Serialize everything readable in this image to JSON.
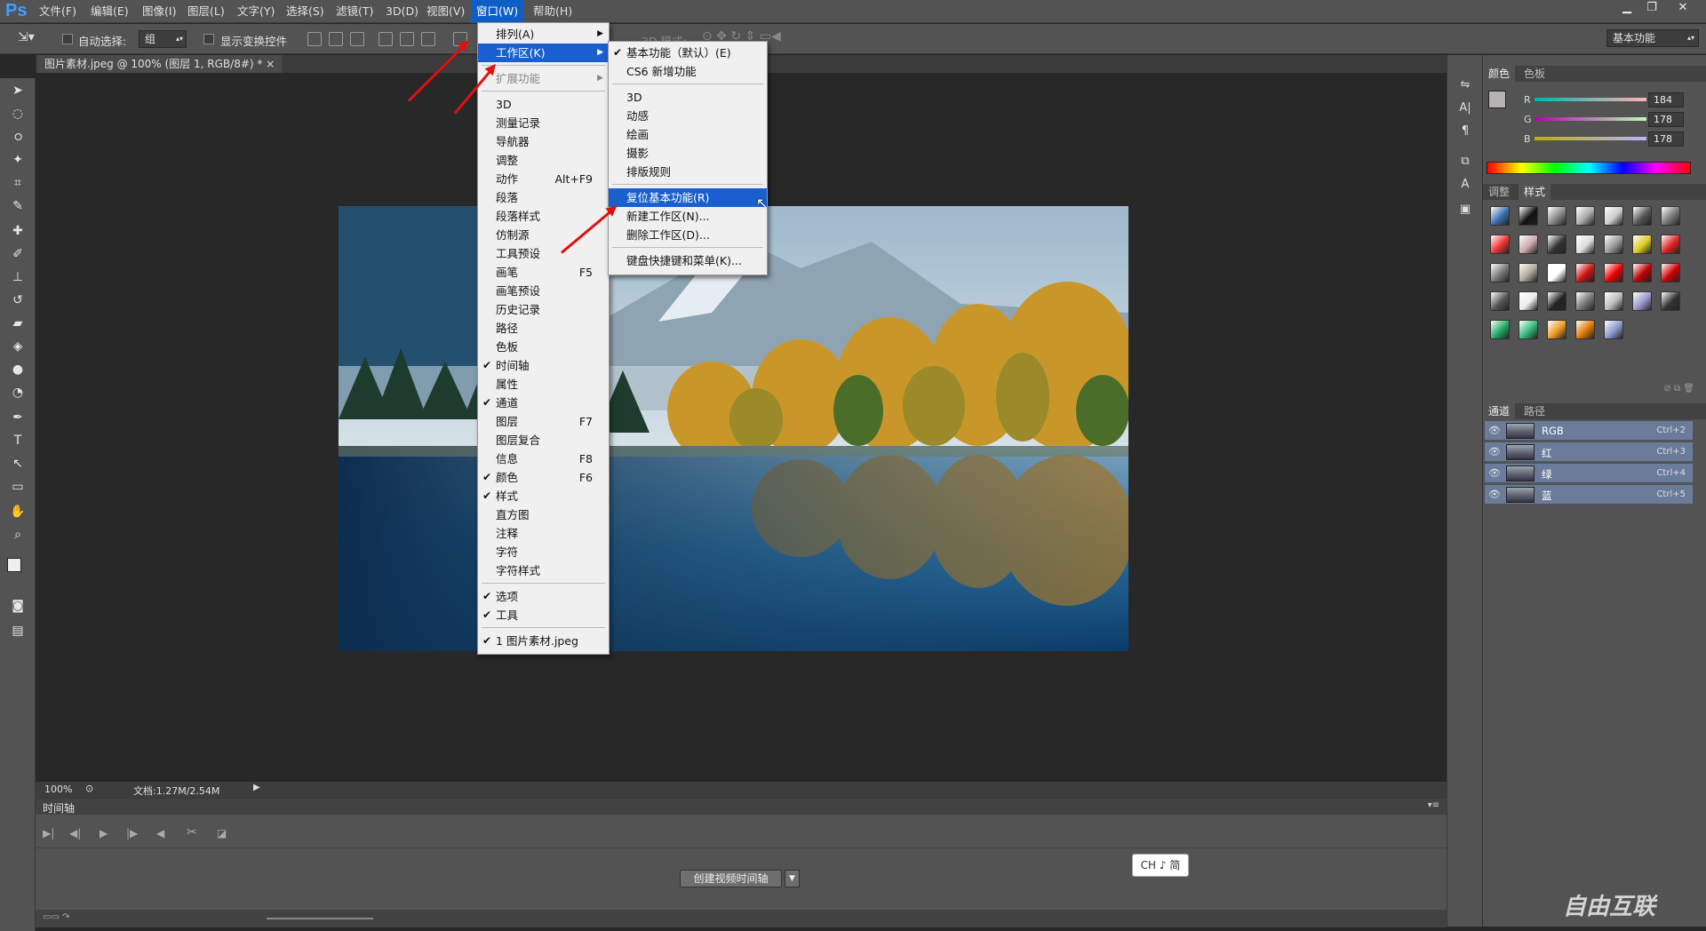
{
  "app": {
    "logo": "Ps"
  },
  "menubar": {
    "items": [
      "文件(F)",
      "编辑(E)",
      "图像(I)",
      "图层(L)",
      "文字(Y)",
      "选择(S)",
      "滤镜(T)",
      "3D(D)",
      "视图(V)",
      "窗口(W)",
      "帮助(H)"
    ],
    "active_index": 9
  },
  "window_controls": [
    "minimize",
    "restore",
    "close"
  ],
  "options": {
    "auto_select_label": "自动选择:",
    "auto_select_value": "组",
    "show_transform_label": "显示变换控件",
    "mode_partial": "3D 模式:",
    "workspace": "基本功能"
  },
  "document": {
    "tab_label": "图片素材.jpeg @ 100% (图层 1, RGB/8#) *",
    "close_glyph": "×"
  },
  "status": {
    "zoom": "100%",
    "doc_info": "文档:1.27M/2.54M"
  },
  "timeline": {
    "tab": "时间轴",
    "create_button": "创建视频时间轴"
  },
  "ime": {
    "text": "CH ♪ 简"
  },
  "color_panel": {
    "tabs": [
      "颜色",
      "色板"
    ],
    "channels": [
      {
        "name": "R",
        "value": "184"
      },
      {
        "name": "G",
        "value": "178"
      },
      {
        "name": "B",
        "value": "178"
      }
    ]
  },
  "styles_panel": {
    "tabs": [
      "调整",
      "样式"
    ]
  },
  "channels_panel": {
    "tabs": [
      "通道",
      "路径"
    ],
    "rows": [
      {
        "name": "RGB",
        "key": "Ctrl+2"
      },
      {
        "name": "红",
        "key": "Ctrl+3"
      },
      {
        "name": "绿",
        "key": "Ctrl+4"
      },
      {
        "name": "蓝",
        "key": "Ctrl+5"
      }
    ]
  },
  "window_menu": [
    {
      "label": "排列(A)",
      "submenu": true
    },
    {
      "label": "工作区(K)",
      "submenu": true,
      "highlight": true
    },
    {
      "sep": true
    },
    {
      "label": "扩展功能",
      "submenu": true,
      "disabled": true
    },
    {
      "sep": true
    },
    {
      "label": "3D"
    },
    {
      "label": "测量记录"
    },
    {
      "label": "导航器"
    },
    {
      "label": "调整"
    },
    {
      "label": "动作",
      "key": "Alt+F9"
    },
    {
      "label": "段落"
    },
    {
      "label": "段落样式"
    },
    {
      "label": "仿制源"
    },
    {
      "label": "工具预设"
    },
    {
      "label": "画笔",
      "key": "F5"
    },
    {
      "label": "画笔预设"
    },
    {
      "label": "历史记录"
    },
    {
      "label": "路径"
    },
    {
      "label": "色板"
    },
    {
      "label": "时间轴",
      "checked": true
    },
    {
      "label": "属性"
    },
    {
      "label": "通道",
      "checked": true
    },
    {
      "label": "图层",
      "key": "F7"
    },
    {
      "label": "图层复合"
    },
    {
      "label": "信息",
      "key": "F8"
    },
    {
      "label": "颜色",
      "key": "F6",
      "checked": true
    },
    {
      "label": "样式",
      "checked": true
    },
    {
      "label": "直方图"
    },
    {
      "label": "注释"
    },
    {
      "label": "字符"
    },
    {
      "label": "字符样式"
    },
    {
      "sep": true
    },
    {
      "label": "选项",
      "checked": true
    },
    {
      "label": "工具",
      "checked": true
    },
    {
      "sep": true
    },
    {
      "label": "1 图片素材.jpeg",
      "checked": true
    }
  ],
  "workspace_submenu": [
    {
      "label": "基本功能（默认）(E)",
      "checked": true
    },
    {
      "label": "CS6 新增功能"
    },
    {
      "sep": true
    },
    {
      "label": "3D"
    },
    {
      "label": "动感"
    },
    {
      "label": "绘画"
    },
    {
      "label": "摄影"
    },
    {
      "label": "排版规则"
    },
    {
      "sep": true
    },
    {
      "label": "复位基本功能(R)",
      "highlight": true
    },
    {
      "label": "新建工作区(N)..."
    },
    {
      "label": "删除工作区(D)..."
    },
    {
      "sep": true
    },
    {
      "label": "键盘快捷键和菜单(K)..."
    }
  ],
  "watermark": {
    "text": "自由互联"
  }
}
